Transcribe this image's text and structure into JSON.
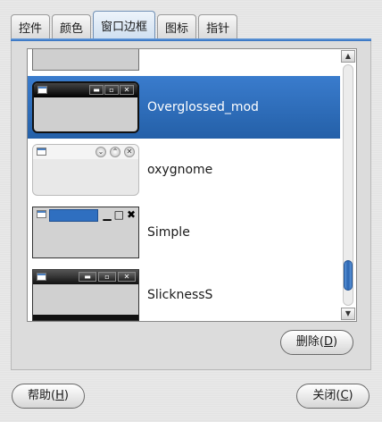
{
  "tabs": [
    {
      "label": "控件",
      "active": false
    },
    {
      "label": "颜色",
      "active": false
    },
    {
      "label": "窗口边框",
      "active": true
    },
    {
      "label": "图标",
      "active": false
    },
    {
      "label": "指针",
      "active": false
    }
  ],
  "themes": [
    {
      "name": "",
      "style": "partial"
    },
    {
      "name": "Overglossed_mod",
      "style": "overglossed",
      "selected": true
    },
    {
      "name": "oxygnome",
      "style": "oxygnome"
    },
    {
      "name": "Simple",
      "style": "simple"
    },
    {
      "name": "SlicknessS",
      "style": "slickness"
    }
  ],
  "scrollbar": {
    "up_icon": "arrow-up-icon",
    "down_icon": "arrow-down-icon"
  },
  "buttons": {
    "delete": {
      "text": "删除(",
      "mnemonic": "D",
      "end": ")"
    },
    "help": {
      "text": "帮助(",
      "mnemonic": "H",
      "end": ")"
    },
    "close": {
      "text": "关闭(",
      "mnemonic": "C",
      "end": ")"
    }
  },
  "colors": {
    "accent": "#2f6fc0",
    "selection": "#2460a8"
  }
}
